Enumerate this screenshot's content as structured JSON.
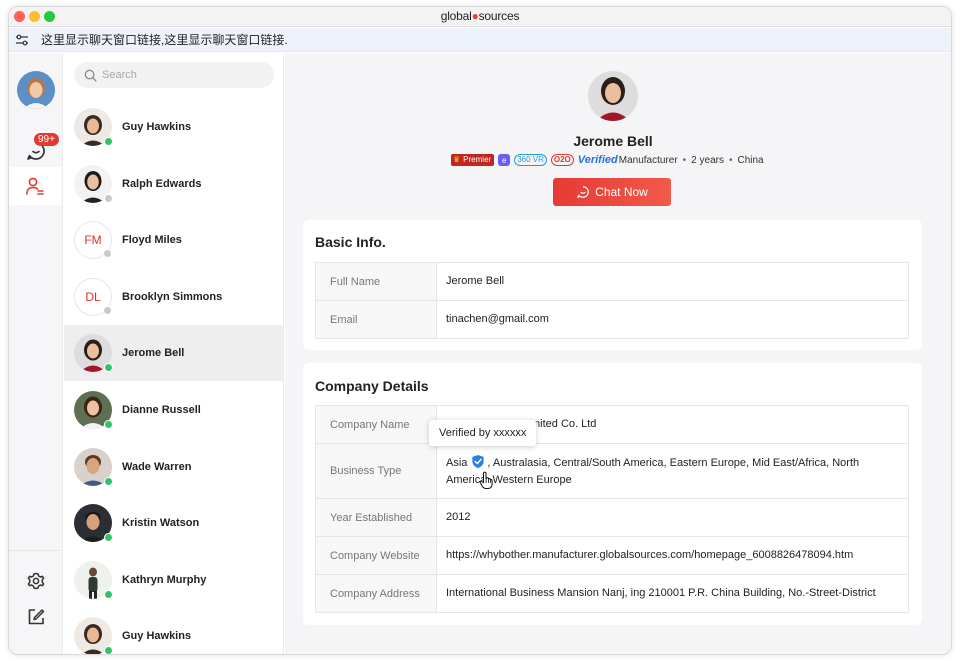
{
  "window": {
    "brand_prefix": "global",
    "brand_suffix": "sources"
  },
  "link_bar": {
    "text": "这里显示聊天窗口链接,这里显示聊天窗口链接."
  },
  "rail": {
    "unread_badge": "99+"
  },
  "search": {
    "placeholder": "Search"
  },
  "contacts": [
    {
      "name": "Guy Hawkins",
      "avatar": "photo",
      "online": true
    },
    {
      "name": "Ralph Edwards",
      "avatar": "photo",
      "online": false
    },
    {
      "name": "Floyd Miles",
      "avatar": "FM",
      "online": false
    },
    {
      "name": "Brooklyn Simmons",
      "avatar": "DL",
      "online": false
    },
    {
      "name": "Jerome Bell",
      "avatar": "photo",
      "online": true,
      "active": true
    },
    {
      "name": "Dianne Russell",
      "avatar": "photo",
      "online": true
    },
    {
      "name": "Wade Warren",
      "avatar": "photo",
      "online": true
    },
    {
      "name": "Kristin Watson",
      "avatar": "photo",
      "online": true
    },
    {
      "name": "Kathryn Murphy",
      "avatar": "photo",
      "online": true
    },
    {
      "name": "Guy Hawkins",
      "avatar": "photo",
      "online": true
    }
  ],
  "profile": {
    "name": "Jerome Bell",
    "badge_premier": "Premier",
    "badge_e": "e",
    "badge_vr": "360 VR",
    "badge_o2o": "O2O",
    "verified_word": "Verified",
    "verified_type": "Manufacturer",
    "years": "2 years",
    "country": "China",
    "chat_button": "Chat Now"
  },
  "basic_info": {
    "title": "Basic Info.",
    "rows": [
      {
        "label": "Full Name",
        "value": "Jerome Bell"
      },
      {
        "label": "Email",
        "value": "tinachen@gmail.com"
      }
    ]
  },
  "company": {
    "title": "Company Details",
    "company_name_label": "Company Name",
    "company_name_visible": "mited Co. Ltd",
    "business_type_label": "Business Type",
    "business_type_prefix": "Asia",
    "business_type_rest": ", Australasia, Central/South America, Eastern Europe, Mid East/Africa, North America, Western Europe",
    "year_label": "Year Established",
    "year_value": "2012",
    "website_label": "Company Website",
    "website_value": "https://whybother.manufacturer.globalsources.com/homepage_6008826478094.htm",
    "address_label": "Company Address",
    "address_value": "International Business Mansion Nanj, ing 210001 P.R. China Building, No.-Street-District",
    "tooltip": "Verified by xxxxxx"
  },
  "colors": {
    "accent_red": "#e63a36",
    "online_green": "#2fc36b",
    "verified_blue": "#2a6fd6"
  }
}
